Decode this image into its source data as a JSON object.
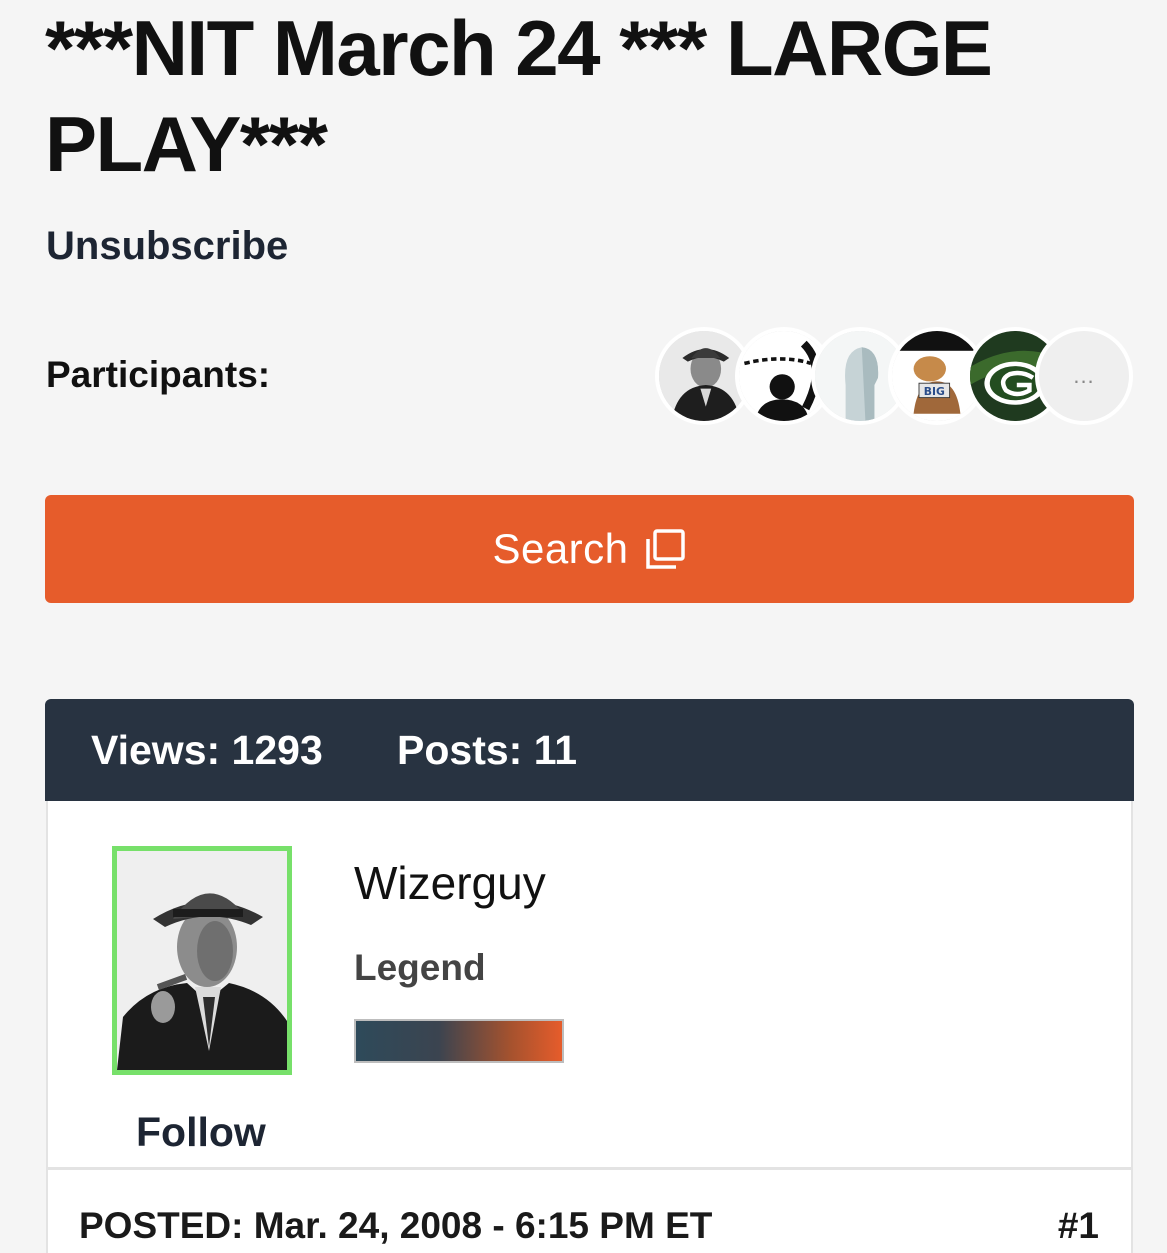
{
  "thread": {
    "title": "***NIT March 24 *** LARGE PLAY***",
    "unsubscribe_label": "Unsubscribe",
    "participants_label": "Participants:",
    "participants": [
      {
        "icon": "man-in-fedora-avatar"
      },
      {
        "icon": "chain-silhouette-avatar"
      },
      {
        "icon": "default-head-avatar"
      },
      {
        "icon": "big-ten-mascot-avatar"
      },
      {
        "icon": "packers-g-logo-avatar"
      }
    ],
    "more_participants_label": "..."
  },
  "search": {
    "label": "Search",
    "icon": "copy-icon",
    "color": "#e65c2b"
  },
  "stats": {
    "views": "Views: 1293",
    "posts": "Posts: 11"
  },
  "post": {
    "username": "Wizerguy",
    "rank": "Legend",
    "follow_label": "Follow",
    "posted": "POSTED: Mar. 24, 2008 - 6:15 PM ET",
    "number": "#1",
    "avatar_border_color": "#77e06a"
  }
}
